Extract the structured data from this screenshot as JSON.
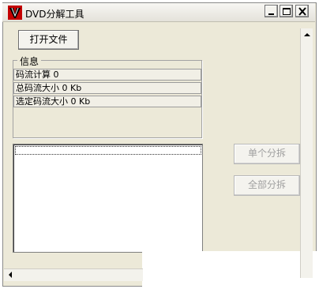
{
  "window": {
    "title": "DVD分解工具",
    "icon": "app-logo-icon",
    "controls": [
      "minimize-icon",
      "maximize-icon",
      "close-icon"
    ]
  },
  "toolbar": {
    "open_file_label": "打开文件"
  },
  "info": {
    "group_label": "信息",
    "rows": [
      "码流计算 0",
      "总码流大小 0 Kb",
      "选定码流大小 0 Kb"
    ]
  },
  "actions": {
    "split_single_label": "单个分拆",
    "split_all_label": "全部分拆"
  },
  "scrollbars": {
    "vertical": "scroll-up-icon",
    "horizontal": "scroll-left-icon"
  }
}
